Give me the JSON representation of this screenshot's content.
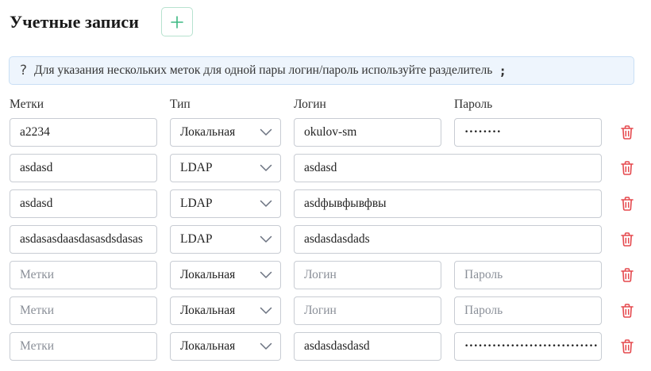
{
  "header": {
    "title": "Учетные записи",
    "add_icon": "plus-icon"
  },
  "info": {
    "icon": "question-icon",
    "text": "Для указания нескольких меток для одной пары логин/пароль используйте разделитель",
    "separator": ";"
  },
  "columns": {
    "tags": "Метки",
    "type": "Тип",
    "login": "Логин",
    "password": "Пароль"
  },
  "placeholders": {
    "tags": "Метки",
    "login": "Логин",
    "password": "Пароль"
  },
  "rows": [
    {
      "tags": "a2234",
      "type": "Локальная",
      "login": "okulov-sm",
      "password": "••••••••"
    },
    {
      "tags": "asdasd",
      "type": "LDAP",
      "login": "asdasd"
    },
    {
      "tags": "asdasd",
      "type": "LDAP",
      "login": "asdфывфывфвы"
    },
    {
      "tags": "asdasasdaasdasasdsdasas",
      "type": "LDAP",
      "login": "asdasdasdads"
    },
    {
      "tags": "",
      "type": "Локальная",
      "login": "",
      "password": ""
    },
    {
      "tags": "",
      "type": "Локальная",
      "login": "",
      "password": ""
    },
    {
      "tags": "",
      "type": "Локальная",
      "login": "asdasdasdasd",
      "password": "•••••••••••••••••••••••••••••"
    }
  ],
  "colors": {
    "accent": "#3cb882",
    "danger": "#e5484d",
    "info_bg": "#eef5fd",
    "border": "#c8ccd3"
  }
}
